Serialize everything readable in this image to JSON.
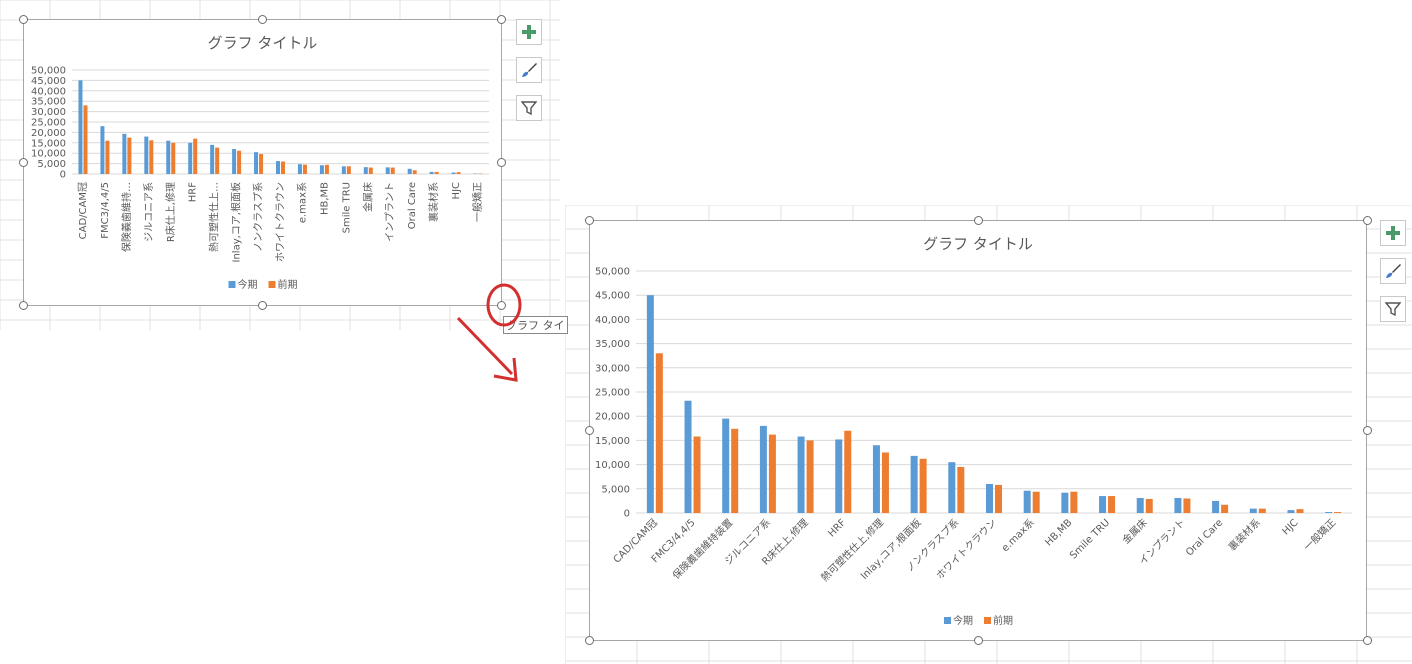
{
  "colors": {
    "series_current": "#5b9bd5",
    "series_previous": "#ed7d31",
    "gridline": "#d9d9d9",
    "axis_text": "#595959",
    "arrow": "#d32f2f"
  },
  "icons": {
    "add_element": "plus-icon",
    "style": "brush-icon",
    "filter": "filter-icon",
    "annotation": "red-circle-annotation",
    "arrow": "red-arrow-annotation"
  },
  "cut_label": "グラフ タイ",
  "chart_data": [
    {
      "type": "bar",
      "title": "グラフ タイトル",
      "categories": [
        "CAD/CAM冠",
        "FMC3/4,4/5",
        "保険義歯維持…",
        "ジルコニア系",
        "R床仕上,修理",
        "HRF",
        "熱可塑性仕上…",
        "Inlay,コア,根面板",
        "ノンクラスプ系",
        "ホワイトクラウン",
        "e.max系",
        "HB,MB",
        "Smile TRU",
        "金属床",
        "インプラント",
        "Oral Care",
        "裏装材系",
        "HJC",
        "一般矯正"
      ],
      "series": [
        {
          "name": "今期",
          "values": [
            45000,
            23000,
            19300,
            18000,
            16000,
            15000,
            14000,
            12000,
            10500,
            6200,
            4700,
            4200,
            3700,
            3300,
            3200,
            2500,
            1000,
            700,
            200
          ]
        },
        {
          "name": "前期",
          "values": [
            33000,
            16000,
            17500,
            16200,
            15000,
            17000,
            12700,
            11200,
            9600,
            6000,
            4500,
            4400,
            3700,
            3100,
            3100,
            1800,
            1000,
            900,
            200
          ]
        }
      ],
      "ylim": [
        0,
        50000
      ],
      "yticks": [
        "0",
        "5,000",
        "10,000",
        "15,000",
        "20,000",
        "25,000",
        "30,000",
        "35,000",
        "40,000",
        "45,000",
        "50,000"
      ],
      "legend": "bottom",
      "grid": true
    },
    {
      "type": "bar",
      "title": "グラフ タイトル",
      "categories": [
        "CAD/CAM冠",
        "FMC3/4,4/5",
        "保険義歯維持装置",
        "ジルコニア系",
        "R床仕上,修理",
        "HRF",
        "熱可塑性仕上,修理",
        "Inlay,コア,根面板",
        "ノンクラスプ系",
        "ホワイトクラウン",
        "e.max系",
        "HB,MB",
        "Smile TRU",
        "金属床",
        "インプラント",
        "Oral Care",
        "裏装材系",
        "HJC",
        "一般矯正"
      ],
      "series": [
        {
          "name": "今期",
          "values": [
            45000,
            23200,
            19500,
            18000,
            15800,
            15200,
            14000,
            11800,
            10500,
            6000,
            4600,
            4200,
            3500,
            3100,
            3100,
            2500,
            900,
            600,
            200
          ]
        },
        {
          "name": "前期",
          "values": [
            33000,
            15800,
            17400,
            16200,
            15000,
            17000,
            12500,
            11200,
            9500,
            5800,
            4400,
            4400,
            3500,
            2900,
            3000,
            1700,
            900,
            800,
            200
          ]
        }
      ],
      "ylim": [
        0,
        50000
      ],
      "yticks": [
        "0",
        "5,000",
        "10,000",
        "15,000",
        "20,000",
        "25,000",
        "30,000",
        "35,000",
        "40,000",
        "45,000",
        "50,000"
      ],
      "legend": "bottom",
      "grid": true
    }
  ]
}
